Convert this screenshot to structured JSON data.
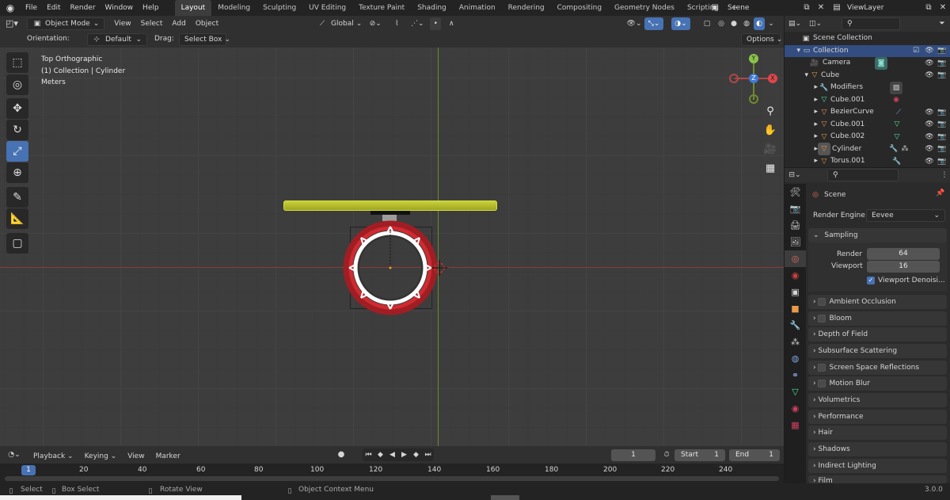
{
  "menus": [
    "File",
    "Edit",
    "Render",
    "Window",
    "Help"
  ],
  "workspaces": [
    "Layout",
    "Modeling",
    "Sculpting",
    "UV Editing",
    "Texture Paint",
    "Shading",
    "Animation",
    "Rendering",
    "Compositing",
    "Geometry Nodes",
    "Scripting"
  ],
  "add_workspace": "+",
  "scene_name": "Scene",
  "view_layer": "ViewLayer",
  "viewport_header": {
    "mode": "Object Mode",
    "view": "View",
    "select": "Select",
    "add": "Add",
    "object": "Object",
    "orientation_value": "Global"
  },
  "tool_header": {
    "orientation_label": "Orientation:",
    "orientation_value": "Default",
    "drag_label": "Drag:",
    "drag_value": "Select Box",
    "options": "Options"
  },
  "overlay": {
    "line1": "Top Orthographic",
    "line2": "(1) Collection | Cylinder",
    "line3": "Meters"
  },
  "gizmo": {
    "y": "Y",
    "x": "X",
    "z": "Z"
  },
  "outliner": {
    "root": "Scene Collection",
    "items": [
      {
        "name": "Collection",
        "level": 0
      },
      {
        "name": "Camera",
        "level": 1
      },
      {
        "name": "Cube",
        "level": 1
      },
      {
        "name": "Modifiers",
        "level": 2
      },
      {
        "name": "Cube.001",
        "level": 2
      },
      {
        "name": "BezierCurve",
        "level": 2
      },
      {
        "name": "Cube.001",
        "level": 2
      },
      {
        "name": "Cube.002",
        "level": 2
      },
      {
        "name": "Cylinder",
        "level": 2
      },
      {
        "name": "Torus.001",
        "level": 2
      }
    ]
  },
  "properties": {
    "context": "Scene",
    "render_engine_label": "Render Engine",
    "render_engine_value": "Eevee",
    "sampling": {
      "title": "Sampling",
      "render_label": "Render",
      "render_value": "64",
      "viewport_label": "Viewport",
      "viewport_value": "16",
      "denoise": "Viewport Denoisi..."
    },
    "panels": [
      {
        "label": "Ambient Occlusion",
        "check": true
      },
      {
        "label": "Bloom",
        "check": true
      },
      {
        "label": "Depth of Field",
        "check": false
      },
      {
        "label": "Subsurface Scattering",
        "check": false
      },
      {
        "label": "Screen Space Reflections",
        "check": true
      },
      {
        "label": "Motion Blur",
        "check": true
      },
      {
        "label": "Volumetrics",
        "check": false
      },
      {
        "label": "Performance",
        "check": false
      },
      {
        "label": "Hair",
        "check": false
      },
      {
        "label": "Shadows",
        "check": false
      },
      {
        "label": "Indirect Lighting",
        "check": false
      },
      {
        "label": "Film",
        "check": false
      }
    ]
  },
  "timeline": {
    "playback": "Playback",
    "keying": "Keying",
    "view": "View",
    "marker": "Marker",
    "current_frame": "1",
    "start_label": "Start",
    "start_value": "1",
    "end_label": "End",
    "end_value": "1",
    "ticks": [
      "1",
      "20",
      "40",
      "60",
      "80",
      "100",
      "120",
      "140",
      "160",
      "180",
      "200",
      "220",
      "240"
    ]
  },
  "status": {
    "select": "Select",
    "box_select": "Box Select",
    "rotate": "Rotate View",
    "context_menu": "Object Context Menu",
    "version": "3.0.0"
  }
}
